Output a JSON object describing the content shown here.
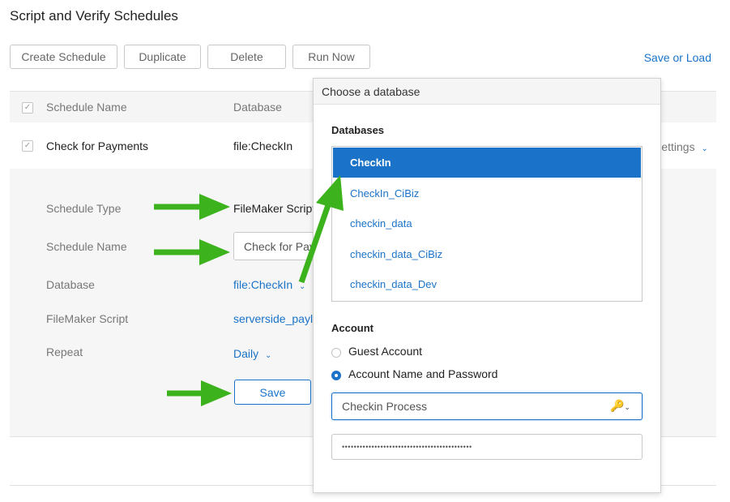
{
  "page": {
    "title": "Script and Verify Schedules"
  },
  "toolbar": {
    "create_label": "Create Schedule",
    "duplicate_label": "Duplicate",
    "delete_label": "Delete",
    "run_now_label": "Run Now",
    "save_or_load_label": "Save or Load"
  },
  "table": {
    "headers": {
      "schedule_name": "Schedule Name",
      "database": "Database"
    },
    "row": {
      "name": "Check for Payments",
      "database": "file:CheckIn",
      "settings_label": "Settings"
    }
  },
  "details": {
    "schedule_type_label": "Schedule Type",
    "schedule_type_value": "FileMaker Script",
    "schedule_name_label": "Schedule Name",
    "schedule_name_value": "Check for Payments",
    "database_label": "Database",
    "database_value": "file:CheckIn",
    "script_label": "FileMaker Script",
    "script_value": "serverside_payl",
    "repeat_label": "Repeat",
    "repeat_value": "Daily",
    "save_label": "Save"
  },
  "popover": {
    "title": "Choose a database",
    "databases_label": "Databases",
    "databases": [
      {
        "name": "CheckIn",
        "selected": true
      },
      {
        "name": "CheckIn_CiBiz",
        "selected": false
      },
      {
        "name": "checkin_data",
        "selected": false
      },
      {
        "name": "checkin_data_CiBiz",
        "selected": false
      },
      {
        "name": "checkin_data_Dev",
        "selected": false
      }
    ],
    "account_label": "Account",
    "guest_label": "Guest Account",
    "account_name_label": "Account Name and Password",
    "account_name_value": "Checkin Process",
    "password_value": "••••••••••••••••••••••••••••••••••••••••••••"
  },
  "colors": {
    "accent": "#1a73c8",
    "arrow": "#3cb21c"
  },
  "icons": {
    "check": "checkmark-icon",
    "chevron": "chevron-down-icon",
    "key": "key-icon"
  }
}
